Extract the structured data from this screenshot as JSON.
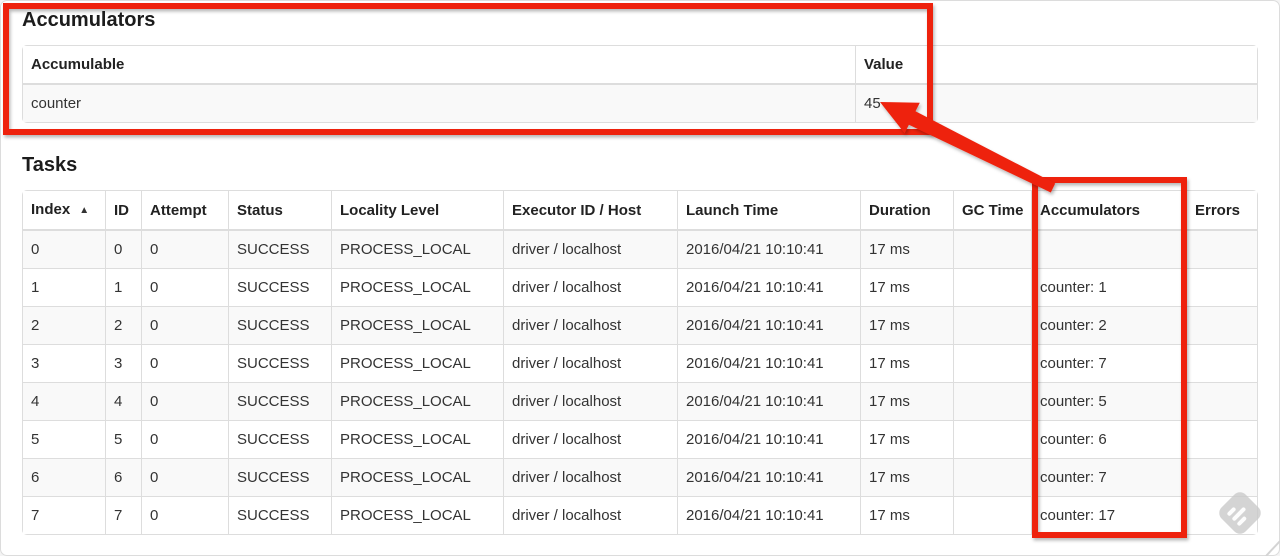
{
  "colors": {
    "accent_red": "#ee220d",
    "stripe": "#f9f9f9",
    "table_border": "#dddddd",
    "text": "#333333",
    "watermark_gray": "#c8c8c8"
  },
  "accumulators_section": {
    "title": "Accumulators",
    "table": {
      "headers": [
        {
          "label": "Accumulable"
        },
        {
          "label": "Value"
        }
      ],
      "rows": [
        [
          "counter",
          "45"
        ]
      ]
    }
  },
  "tasks_section": {
    "title": "Tasks",
    "table": {
      "headers": [
        {
          "label": "Index",
          "sort_indicator": "▲"
        },
        {
          "label": "ID"
        },
        {
          "label": "Attempt"
        },
        {
          "label": "Status"
        },
        {
          "label": "Locality Level"
        },
        {
          "label": "Executor ID / Host"
        },
        {
          "label": "Launch Time"
        },
        {
          "label": "Duration"
        },
        {
          "label": "GC Time"
        },
        {
          "label": "Accumulators"
        },
        {
          "label": "Errors"
        }
      ],
      "rows": [
        [
          "0",
          "0",
          "0",
          "SUCCESS",
          "PROCESS_LOCAL",
          "driver / localhost",
          "2016/04/21 10:10:41",
          "17 ms",
          "",
          "",
          ""
        ],
        [
          "1",
          "1",
          "0",
          "SUCCESS",
          "PROCESS_LOCAL",
          "driver / localhost",
          "2016/04/21 10:10:41",
          "17 ms",
          "",
          "counter: 1",
          ""
        ],
        [
          "2",
          "2",
          "0",
          "SUCCESS",
          "PROCESS_LOCAL",
          "driver / localhost",
          "2016/04/21 10:10:41",
          "17 ms",
          "",
          "counter: 2",
          ""
        ],
        [
          "3",
          "3",
          "0",
          "SUCCESS",
          "PROCESS_LOCAL",
          "driver / localhost",
          "2016/04/21 10:10:41",
          "17 ms",
          "",
          "counter: 7",
          ""
        ],
        [
          "4",
          "4",
          "0",
          "SUCCESS",
          "PROCESS_LOCAL",
          "driver / localhost",
          "2016/04/21 10:10:41",
          "17 ms",
          "",
          "counter: 5",
          ""
        ],
        [
          "5",
          "5",
          "0",
          "SUCCESS",
          "PROCESS_LOCAL",
          "driver / localhost",
          "2016/04/21 10:10:41",
          "17 ms",
          "",
          "counter: 6",
          ""
        ],
        [
          "6",
          "6",
          "0",
          "SUCCESS",
          "PROCESS_LOCAL",
          "driver / localhost",
          "2016/04/21 10:10:41",
          "17 ms",
          "",
          "counter: 7",
          ""
        ],
        [
          "7",
          "7",
          "0",
          "SUCCESS",
          "PROCESS_LOCAL",
          "driver / localhost",
          "2016/04/21 10:10:41",
          "17 ms",
          "",
          "counter: 17",
          ""
        ]
      ]
    }
  }
}
